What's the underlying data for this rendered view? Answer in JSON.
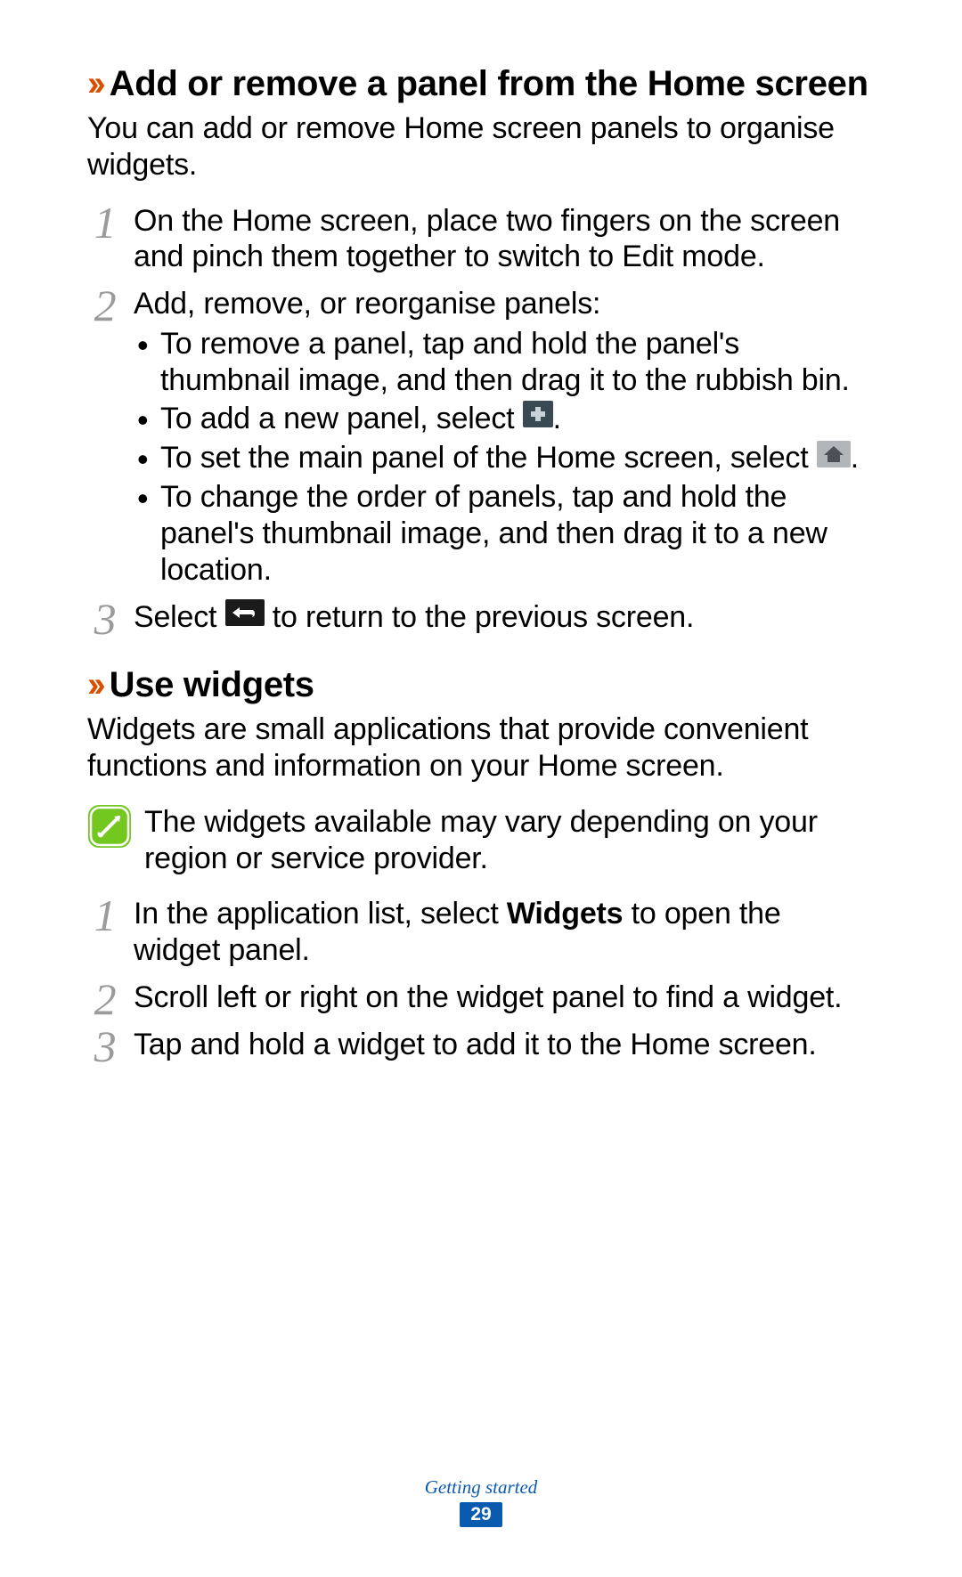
{
  "section1": {
    "heading": "Add or remove a panel from the Home screen",
    "intro": "You can add or remove Home screen panels to organise widgets.",
    "steps": {
      "s1": "On the Home screen, place two fingers on the screen and pinch them together to switch to Edit mode.",
      "s2_lead": "Add, remove, or reorganise panels:",
      "s2_bullets": {
        "b1": "To remove a panel, tap and hold the panel's thumbnail image, and then drag it to the rubbish bin.",
        "b2_pre": "To add a new panel, select ",
        "b2_post": ".",
        "b3_pre": "To set the main panel of the Home screen, select ",
        "b3_post": ".",
        "b4": "To change the order of panels, tap and hold the panel's thumbnail image, and then drag it to a new location."
      },
      "s3_pre": "Select ",
      "s3_post": " to return to the previous screen."
    }
  },
  "section2": {
    "heading": "Use widgets",
    "intro": "Widgets are small applications that provide convenient functions and information on your Home screen.",
    "note": "The widgets available may vary depending on your region or service provider.",
    "steps": {
      "s1_pre": "In the application list, select ",
      "s1_bold": "Widgets",
      "s1_post": " to open the widget panel.",
      "s2": "Scroll left or right on the widget panel to find a widget.",
      "s3": "Tap and hold a widget to add it to the Home screen."
    }
  },
  "footer": {
    "label": "Getting started",
    "page": "29"
  },
  "chevrons": "››"
}
